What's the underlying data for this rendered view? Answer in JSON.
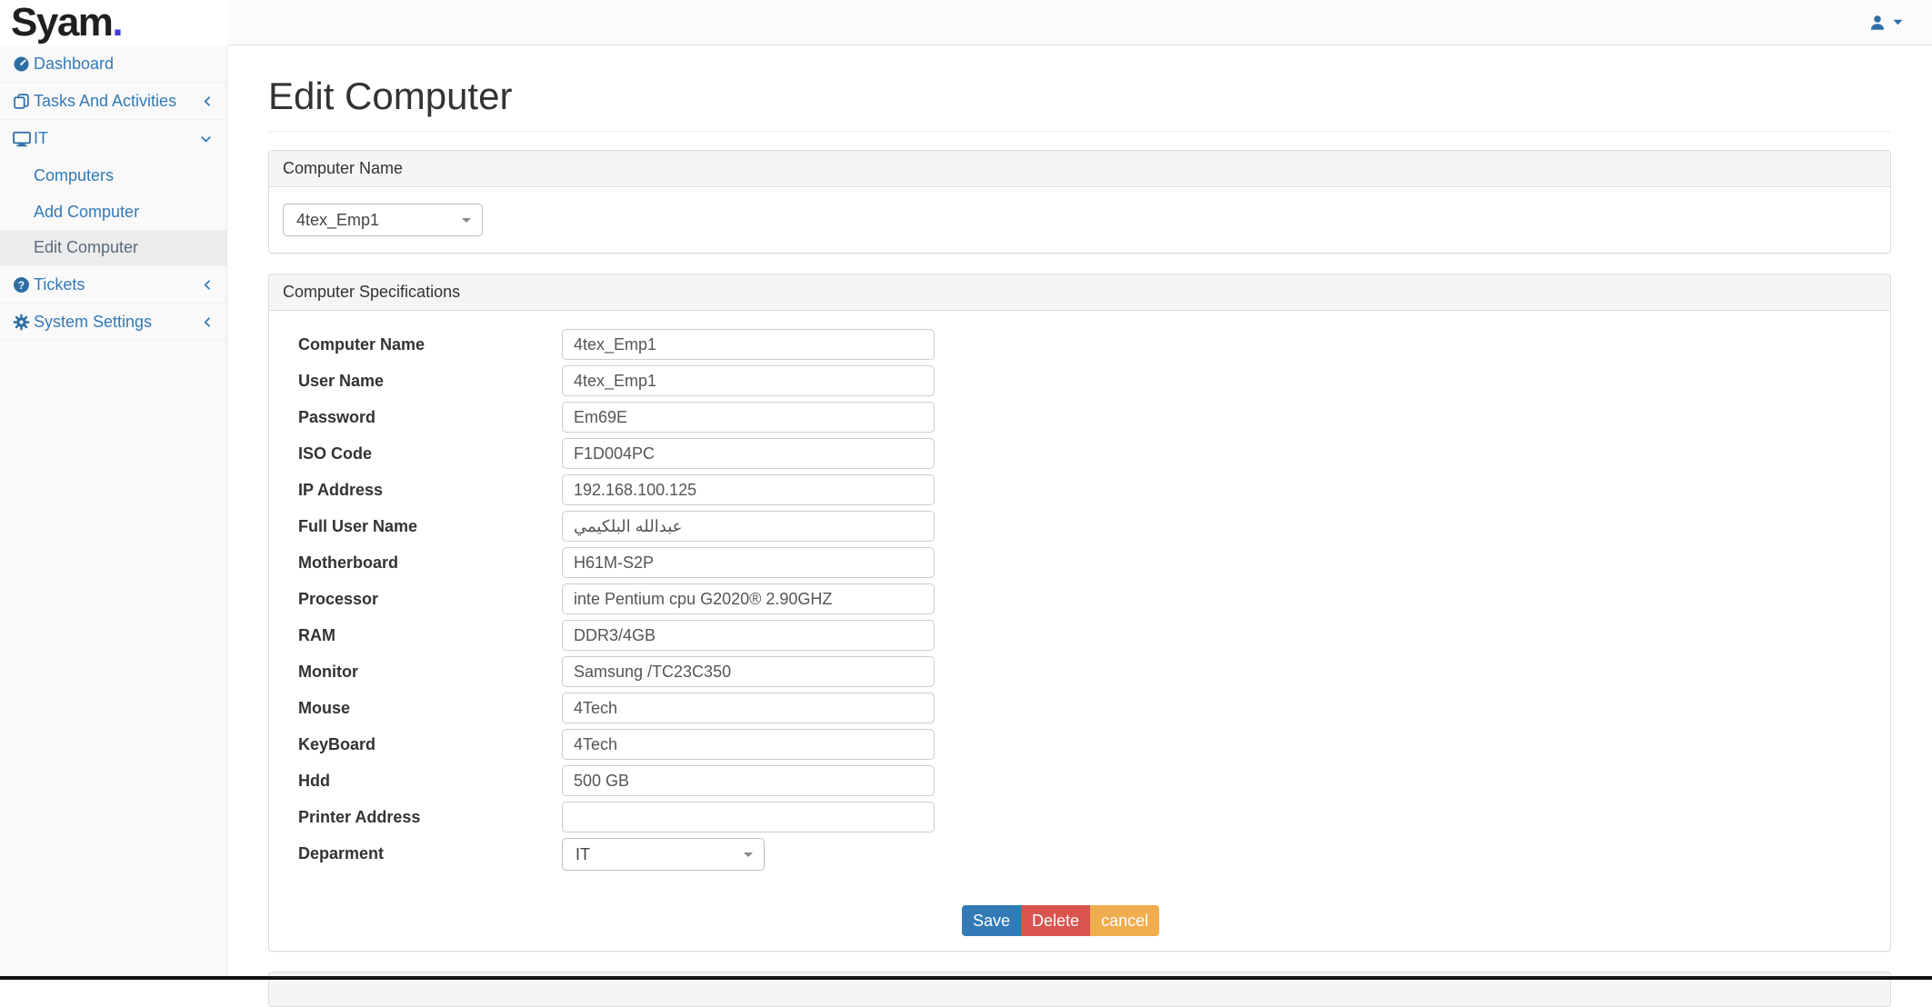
{
  "brand": {
    "name": "Syam",
    "dot": ".",
    "dot_color": "#3c3ce0"
  },
  "colors": {
    "link_blue": "#337ab7",
    "icon_blue": "#2e6da4"
  },
  "header": {
    "user_icon": "user-icon",
    "caret_icon": "caret-down-icon"
  },
  "sidebar": {
    "items": [
      {
        "label": "Dashboard",
        "icon": "dashboard-icon"
      },
      {
        "label": "Tasks And Activities",
        "icon": "tasks-icon",
        "chevron": "left"
      },
      {
        "label": "IT",
        "icon": "desktop-icon",
        "chevron": "down",
        "children": [
          {
            "label": "Computers"
          },
          {
            "label": "Add Computer"
          },
          {
            "label": "Edit Computer",
            "active": true
          }
        ]
      },
      {
        "label": "Tickets",
        "icon": "question-icon",
        "chevron": "left"
      },
      {
        "label": "System Settings",
        "icon": "gear-icon",
        "chevron": "left"
      }
    ]
  },
  "page": {
    "title": "Edit Computer"
  },
  "panels": {
    "computer_name": {
      "title": "Computer Name",
      "selected_value": "4tex_Emp1"
    },
    "specifications": {
      "title": "Computer Specifications",
      "fields": [
        {
          "label": "Computer Name",
          "value": "4tex_Emp1",
          "type": "text"
        },
        {
          "label": "User Name",
          "value": "4tex_Emp1",
          "type": "text"
        },
        {
          "label": "Password",
          "value": "Em69E",
          "type": "text"
        },
        {
          "label": "ISO Code",
          "value": "F1D004PC",
          "type": "text"
        },
        {
          "label": "IP Address",
          "value": "192.168.100.125",
          "type": "text"
        },
        {
          "label": "Full User Name",
          "value": "عبدالله البلكيمي",
          "type": "text"
        },
        {
          "label": "Motherboard",
          "value": "H61M-S2P",
          "type": "text"
        },
        {
          "label": "Processor",
          "value": "inte Pentium cpu G2020® 2.90GHZ",
          "type": "text"
        },
        {
          "label": "RAM",
          "value": "DDR3/4GB",
          "type": "text"
        },
        {
          "label": "Monitor",
          "value": "Samsung /TC23C350",
          "type": "text"
        },
        {
          "label": "Mouse",
          "value": "4Tech",
          "type": "text"
        },
        {
          "label": "KeyBoard",
          "value": "4Tech",
          "type": "text"
        },
        {
          "label": "Hdd",
          "value": "500 GB",
          "type": "text"
        },
        {
          "label": "Printer Address",
          "value": "",
          "type": "text"
        },
        {
          "label": "Deparment",
          "value": "IT",
          "type": "select"
        }
      ],
      "buttons": [
        {
          "label": "Save",
          "color": "#337ab7"
        },
        {
          "label": "Delete",
          "color": "#d9534f"
        },
        {
          "label": "cancel",
          "color": "#f0ad4e"
        }
      ]
    }
  }
}
